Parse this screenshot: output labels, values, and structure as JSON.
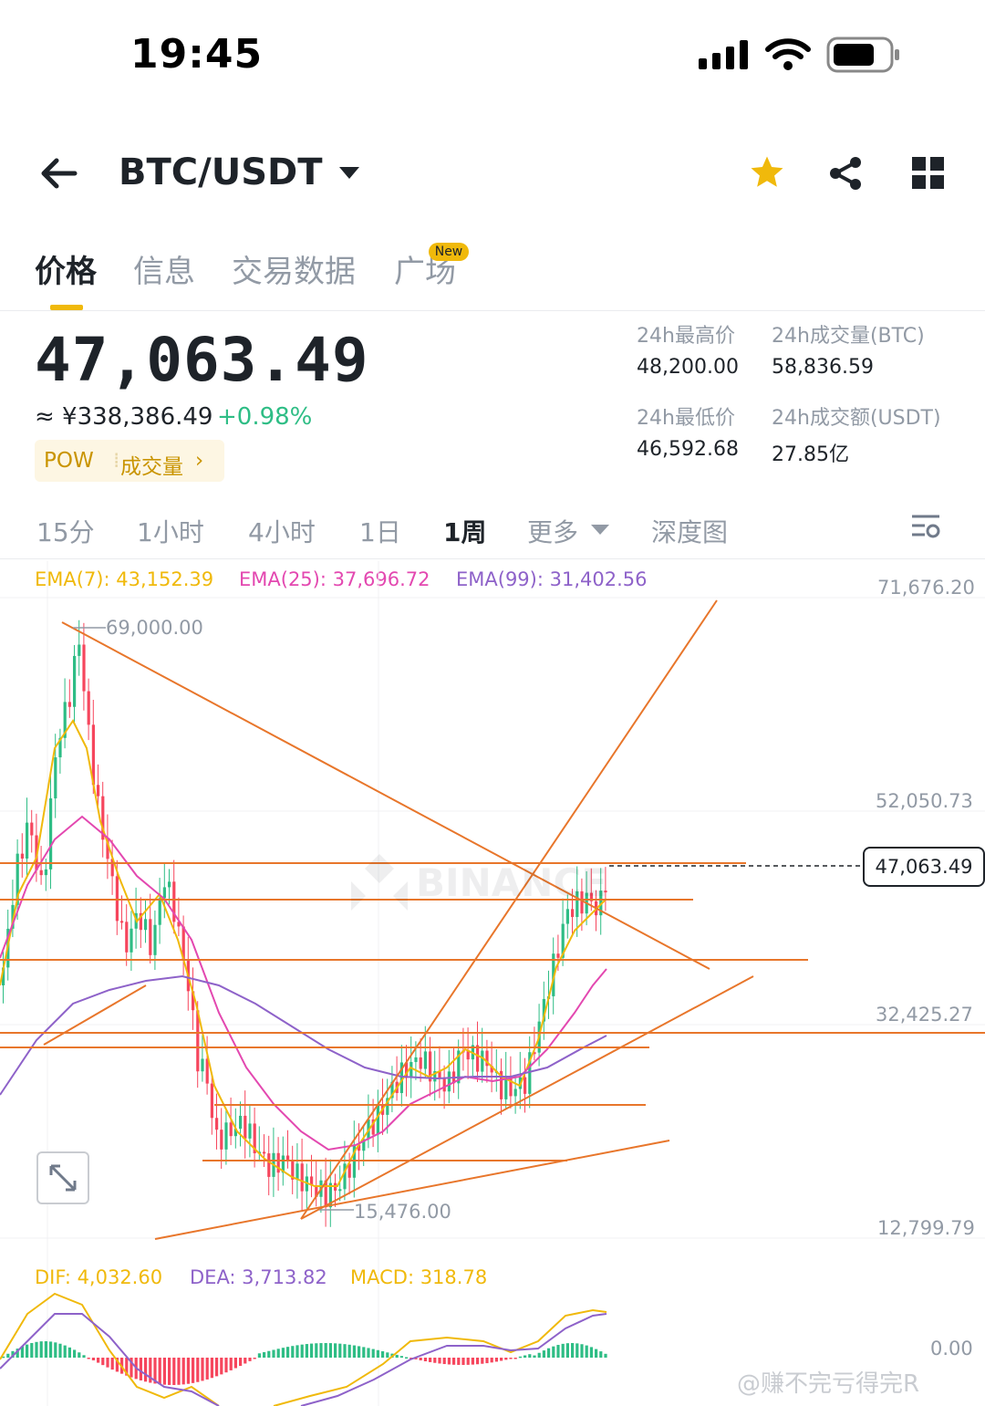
{
  "status_bar": {
    "time": "19:45"
  },
  "header": {
    "pair": "BTC/USDT"
  },
  "tabs": [
    {
      "label": "价格",
      "active": true
    },
    {
      "label": "信息"
    },
    {
      "label": "交易数据"
    },
    {
      "label": "广场",
      "badge": "New"
    }
  ],
  "ticker": {
    "price": "47,063.49",
    "cny": "≈ ¥338,386.49",
    "change": "+0.98%",
    "tag": "POW",
    "volume_link": "成交量"
  },
  "stats": {
    "high_label": "24h最高价",
    "high": "48,200.00",
    "vol_btc_label": "24h成交量(BTC)",
    "vol_btc": "58,836.59",
    "low_label": "24h最低价",
    "low": "46,592.68",
    "vol_usdt_label": "24h成交额(USDT)",
    "vol_usdt": "27.85亿"
  },
  "intervals": [
    "15分",
    "1小时",
    "4小时",
    "1日",
    "1周",
    "更多",
    "深度图"
  ],
  "active_interval": "1周",
  "ema": {
    "ema7": "EMA(7): 43,152.39",
    "ema25": "EMA(25): 37,696.72",
    "ema99": "EMA(99): 31,402.56"
  },
  "y_axis": [
    "71,676.20",
    "52,050.73",
    "32,425.27",
    "12,799.79"
  ],
  "annotations": {
    "high": "69,000.00",
    "low": "15,476.00",
    "current": "47,063.49"
  },
  "macd": {
    "dif": "DIF: 4,032.60",
    "dea": "DEA: 3,713.82",
    "macd": "MACD: 318.78",
    "zero": "0.00"
  },
  "watermark": "@赚不完亏得完R",
  "colors": {
    "up": "#2ebd85",
    "down": "#f6465d",
    "accent": "#f0b90b",
    "ema7": "#f0b90b",
    "ema25": "#e348b0",
    "ema99": "#8e62c9",
    "trend": "#e8762b"
  }
}
